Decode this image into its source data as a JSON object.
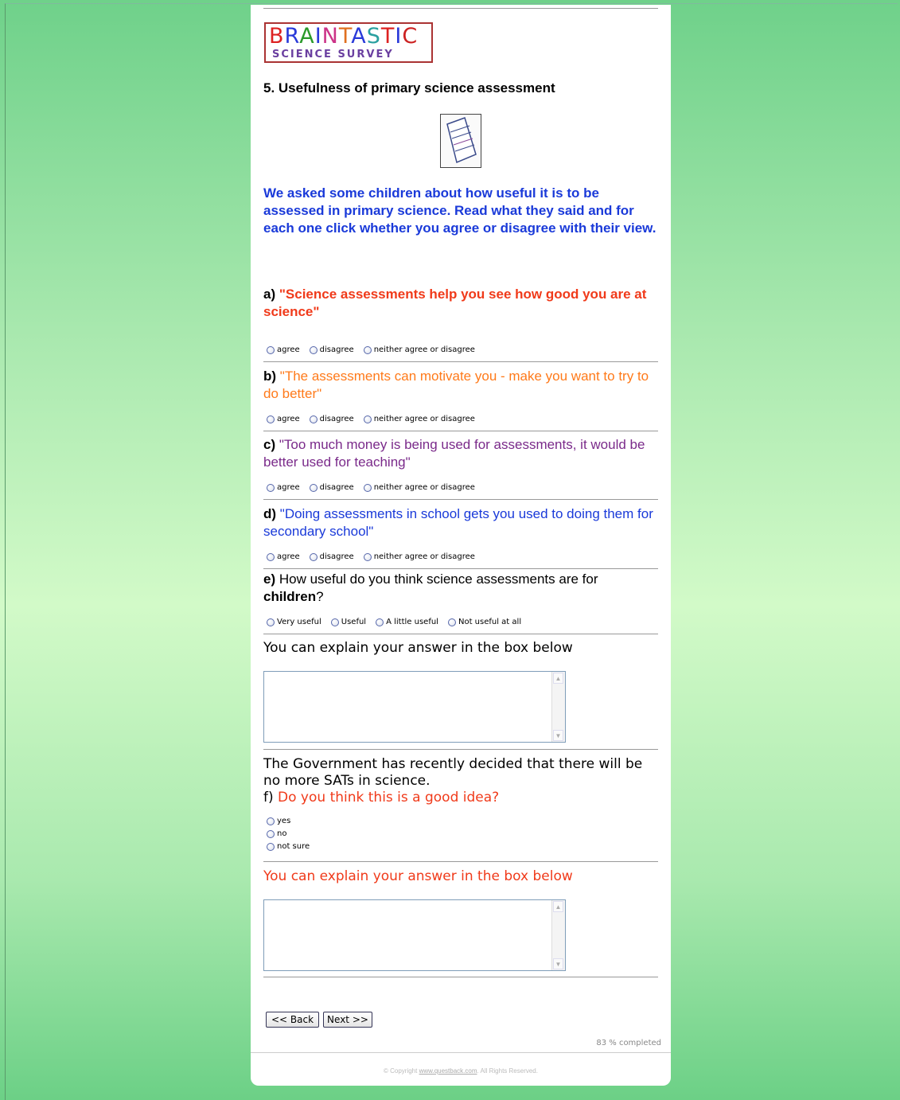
{
  "logo": {
    "line1_letters": [
      {
        "ch": "B",
        "color": "#d22"
      },
      {
        "ch": "R",
        "color": "#2a3ad9"
      },
      {
        "ch": "A",
        "color": "#2a9a2a"
      },
      {
        "ch": "I",
        "color": "#2a3ad9"
      },
      {
        "ch": "N",
        "color": "#c38"
      },
      {
        "ch": "T",
        "color": "#e07020"
      },
      {
        "ch": "A",
        "color": "#2a3ad9"
      },
      {
        "ch": "S",
        "color": "#2aa0a0"
      },
      {
        "ch": "T",
        "color": "#d22"
      },
      {
        "ch": "I",
        "color": "#2a3ad9"
      },
      {
        "ch": "C",
        "color": "#c22"
      }
    ],
    "line2": "SCIENCE SURVEY"
  },
  "question_title": "5. Usefulness of primary science assessment",
  "intro": "We asked some children about how useful it is to be assessed in primary science. Read what they said and for each one click whether you agree or disagree with their view.",
  "statements": [
    {
      "letter": "a)",
      "text": "\"Science assessments help you see how good you are at science\"",
      "color": "#f03a1a",
      "bold": true
    },
    {
      "letter": "b)",
      "text": "\"The assessments can motivate you - make you want to try to do better\"",
      "color": "#ff7a1a",
      "bold": false
    },
    {
      "letter": "c)",
      "text": "\"Too much money is being used for assessments, it would be better used for teaching\"",
      "color": "#7a2a8a",
      "bold": false
    },
    {
      "letter": "d)",
      "text": "\"Doing assessments in school gets you used to doing them for secondary school\"",
      "color": "#1a3ad9",
      "bold": false
    }
  ],
  "agree_options": [
    "agree",
    "disagree",
    "neither agree or disagree"
  ],
  "question_e": {
    "letter": "e)",
    "text_before": "How useful do you think science assessments are for",
    "text_bold": "children",
    "text_after": "?"
  },
  "usefulness_options": [
    "Very useful",
    "Useful",
    "A little useful",
    "Not useful at all"
  ],
  "explain_label_1": "You can explain your answer in the box below",
  "gov_line": "The Government has recently decided that there will be no more SATs in science.",
  "question_f": {
    "letter": "f)",
    "text": "Do you think this is a good idea?",
    "color": "#f03a1a"
  },
  "yes_no_options": [
    "yes",
    "no",
    "not sure"
  ],
  "explain_label_2": "You can explain your answer in the box below",
  "explain_label_2_color": "#f03a1a",
  "buttons": {
    "back": "<< Back",
    "next": "Next >>"
  },
  "progress": "83 % completed",
  "copyright": {
    "prefix": "© Copyright ",
    "link": "www.questback.com",
    "suffix": ". All Rights Reserved."
  }
}
